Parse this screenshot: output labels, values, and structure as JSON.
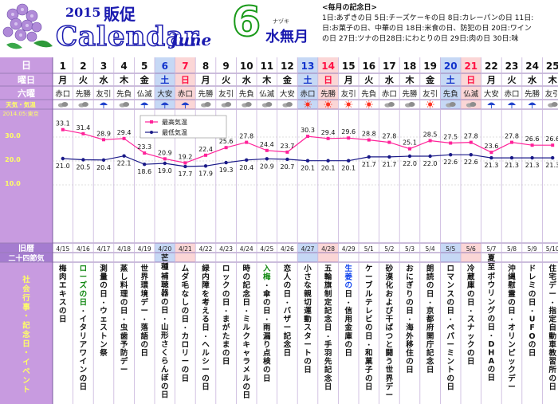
{
  "header": {
    "year": "2015",
    "hansoku": "販促",
    "calendar": "Calendar",
    "month_en": "June",
    "month_num": "6",
    "furigana": "ナヅキ",
    "month_jp": "水無月"
  },
  "kinenbi": {
    "title": "<毎月の記念日>",
    "lines": [
      "1日:あずきの日 5日:チーズケーキの日 8日:カレーパンの日 11日:",
      "日:お菓子の日、中華の日 18日:米食の日、防犯の日 20日:ワイン",
      "の日 27日:ツナの日28日:にわとりの日 29日:肉の日 30日:味"
    ]
  },
  "row_labels": {
    "date": "日",
    "weekday": "曜日",
    "rokuyo": "六曜",
    "weather": "天気・気温",
    "weather_sub": "2014.05:東京",
    "y30": "30.0",
    "y20": "20.0",
    "y10": "10.0",
    "kyureki": "旧暦",
    "sekki": "二十四節気",
    "events": "社会行事・記念日・イベント"
  },
  "legend": {
    "max": "最高気温",
    "min": "最低気温"
  },
  "days": [
    {
      "d": "1",
      "w": "月",
      "r": "赤口",
      "wx": "cloud",
      "kyu": "4/15",
      "s": "",
      "ev": "梅肉エキスの日"
    },
    {
      "d": "2",
      "w": "火",
      "r": "先勝",
      "wx": "cloud",
      "kyu": "4/16",
      "s": "",
      "ev": "ローズの日・イタリアワインの日"
    },
    {
      "d": "3",
      "w": "水",
      "r": "友引",
      "wx": "umbrella",
      "kyu": "4/17",
      "s": "",
      "ev": "測量の日・ウェストン祭"
    },
    {
      "d": "4",
      "w": "木",
      "r": "先負",
      "wx": "cloud",
      "kyu": "4/18",
      "s": "",
      "ev": "蒸し料理の日・虫歯予防デー"
    },
    {
      "d": "5",
      "w": "金",
      "r": "仏滅",
      "wx": "umbrella",
      "kyu": "4/19",
      "s": "",
      "ev": "世界環境デー・落語の日"
    },
    {
      "d": "6",
      "w": "土",
      "r": "大安",
      "wx": "umbrella",
      "kyu": "4/20",
      "s": "芒種",
      "ev": "補聴器の日・山形さくらんぼの日"
    },
    {
      "d": "7",
      "w": "日",
      "r": "赤口",
      "wx": "umbrella",
      "kyu": "4/21",
      "s": "",
      "ev": "ムダ毛なしの日・カロリーの日"
    },
    {
      "d": "8",
      "w": "月",
      "r": "先勝",
      "wx": "cloud",
      "kyu": "4/22",
      "s": "",
      "ev": "緑内障を考える日・ヘルシーの日"
    },
    {
      "d": "9",
      "w": "火",
      "r": "友引",
      "wx": "cloud",
      "kyu": "4/23",
      "s": "",
      "ev": "ロックの日・まがたまの日"
    },
    {
      "d": "10",
      "w": "水",
      "r": "先負",
      "wx": "cloud",
      "kyu": "4/24",
      "s": "",
      "ev": "時の記念日・ミルクキャラメルの日"
    },
    {
      "d": "11",
      "w": "木",
      "r": "仏滅",
      "wx": "cloud",
      "kyu": "4/25",
      "s": "",
      "ev": "入梅・傘の日・雨漏り点検の日"
    },
    {
      "d": "12",
      "w": "金",
      "r": "大安",
      "wx": "cloud",
      "kyu": "4/26",
      "s": "",
      "ev": "恋人の日・バザー記念日"
    },
    {
      "d": "13",
      "w": "土",
      "r": "赤口",
      "wx": "sun",
      "kyu": "4/27",
      "s": "",
      "ev": "小さな親切運動スタートの日"
    },
    {
      "d": "14",
      "w": "日",
      "r": "先勝",
      "wx": "sun",
      "kyu": "4/28",
      "s": "",
      "ev": "五輪旗制定記念日・手羽先記念日"
    },
    {
      "d": "15",
      "w": "月",
      "r": "友引",
      "wx": "sun",
      "kyu": "4/29",
      "s": "",
      "ev": "生姜の日・信用金庫の日"
    },
    {
      "d": "16",
      "w": "火",
      "r": "先負",
      "wx": "sun",
      "kyu": "5/1",
      "s": "",
      "ev": "ケーブルテレビの日・和菓子の日"
    },
    {
      "d": "17",
      "w": "水",
      "r": "赤口",
      "wx": "cloud",
      "kyu": "5/2",
      "s": "",
      "ev": "砂漠化および干ばつと闘う世界デー"
    },
    {
      "d": "18",
      "w": "木",
      "r": "先勝",
      "wx": "cloud",
      "kyu": "5/3",
      "s": "",
      "ev": "おにぎりの日・海外移住の日"
    },
    {
      "d": "19",
      "w": "金",
      "r": "友引",
      "wx": "sun",
      "kyu": "5/4",
      "s": "",
      "ev": "朗読の日・京都府開庁記念日"
    },
    {
      "d": "20",
      "w": "土",
      "r": "先負",
      "wx": "cloud",
      "kyu": "5/5",
      "s": "",
      "ev": "ロマンスの日・ペパーミントの日"
    },
    {
      "d": "21",
      "w": "日",
      "r": "仏滅",
      "wx": "cloud",
      "kyu": "5/6",
      "s": "",
      "ev": "冷蔵庫の日・スナックの日"
    },
    {
      "d": "22",
      "w": "月",
      "r": "大安",
      "wx": "umbrella",
      "kyu": "5/7",
      "s": "夏至",
      "ev": "ボウリングの日・DHAの日"
    },
    {
      "d": "23",
      "w": "火",
      "r": "赤口",
      "wx": "umbrella",
      "kyu": "5/8",
      "s": "",
      "ev": "沖縄慰霊の日・オリンピックデー"
    },
    {
      "d": "24",
      "w": "水",
      "r": "先勝",
      "wx": "umbrella",
      "kyu": "5/9",
      "s": "",
      "ev": "ドレミの日・UFOの日"
    },
    {
      "d": "25",
      "w": "木",
      "r": "友引",
      "wx": "cloud",
      "kyu": "5/10",
      "s": "",
      "ev": "住宅デー・指定自動車教習所の日"
    }
  ],
  "temps": {
    "max": [
      33.1,
      31.4,
      28.9,
      29.4,
      23.3,
      20.9,
      19.2,
      22.4,
      25.6,
      27.8,
      24.4,
      23.7,
      30.3,
      29.4,
      29.6,
      28.8,
      27.8,
      25.1,
      28.5,
      27.5,
      27.8,
      23.6,
      27.8,
      26.6,
      26.6
    ],
    "min": [
      21.0,
      20.5,
      20.4,
      22.1,
      18.6,
      19.0,
      17.7,
      17.9,
      19.3,
      20.4,
      20.9,
      20.7,
      20.1,
      20.1,
      20.1,
      21.7,
      21.7,
      22.0,
      22.0,
      22.6,
      22.6,
      21.3,
      21.3,
      21.3,
      21.3
    ]
  },
  "colors": {
    "label_bg": "#c89be0",
    "label_bg_dark": "#a57cd0",
    "label_text": "#ffffff",
    "label_text_yellow": "#ffff66",
    "sat_bg": "#c6d8f5",
    "sun_bg": "#fbd6d6",
    "sat_text": "#1133cc",
    "sun_text": "#ff1144",
    "max_line": "#ff2299",
    "min_line": "#1a1a88",
    "event_text": "#111111",
    "event_green": "#118811",
    "event_blue": "#1144ee"
  }
}
